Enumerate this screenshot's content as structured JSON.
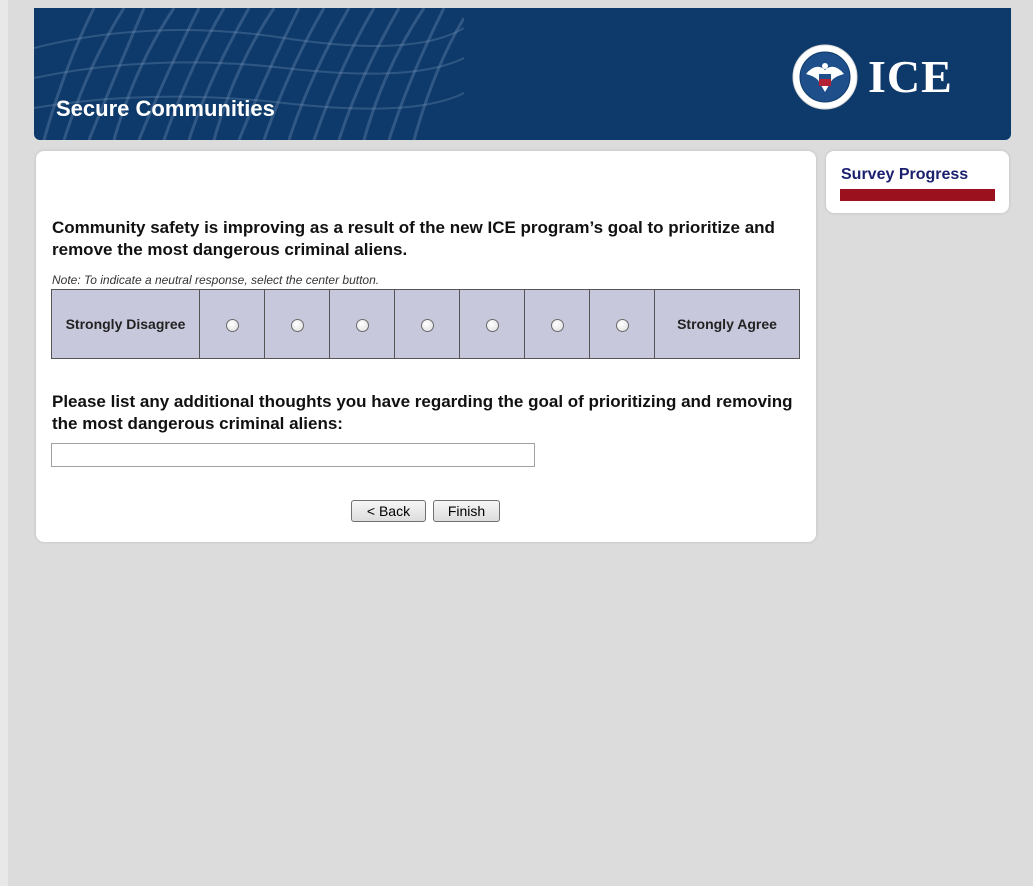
{
  "header": {
    "title": "Secure Communities",
    "agency_mark": "ICE",
    "seal_icon": "dhs-seal-icon",
    "background_color": "#0e3a6b"
  },
  "survey": {
    "question": "Community safety is improving as a result of the new ICE program’s goal to prioritize and remove the most dangerous criminal aliens.",
    "note": "Note: To indicate a neutral response, select the center button.",
    "scale": {
      "left_label": "Strongly Disagree",
      "right_label": "Strongly Agree",
      "option_count": 7,
      "selected": null
    },
    "followup_question": "Please list any additional thoughts you have regarding the goal of prioritizing and removing the most dangerous criminal aliens:",
    "followup_value": "",
    "back_label": "< Back",
    "finish_label": "Finish"
  },
  "progress": {
    "title": "Survey Progress",
    "fraction": 1.0,
    "fill_color": "#9b111e"
  }
}
